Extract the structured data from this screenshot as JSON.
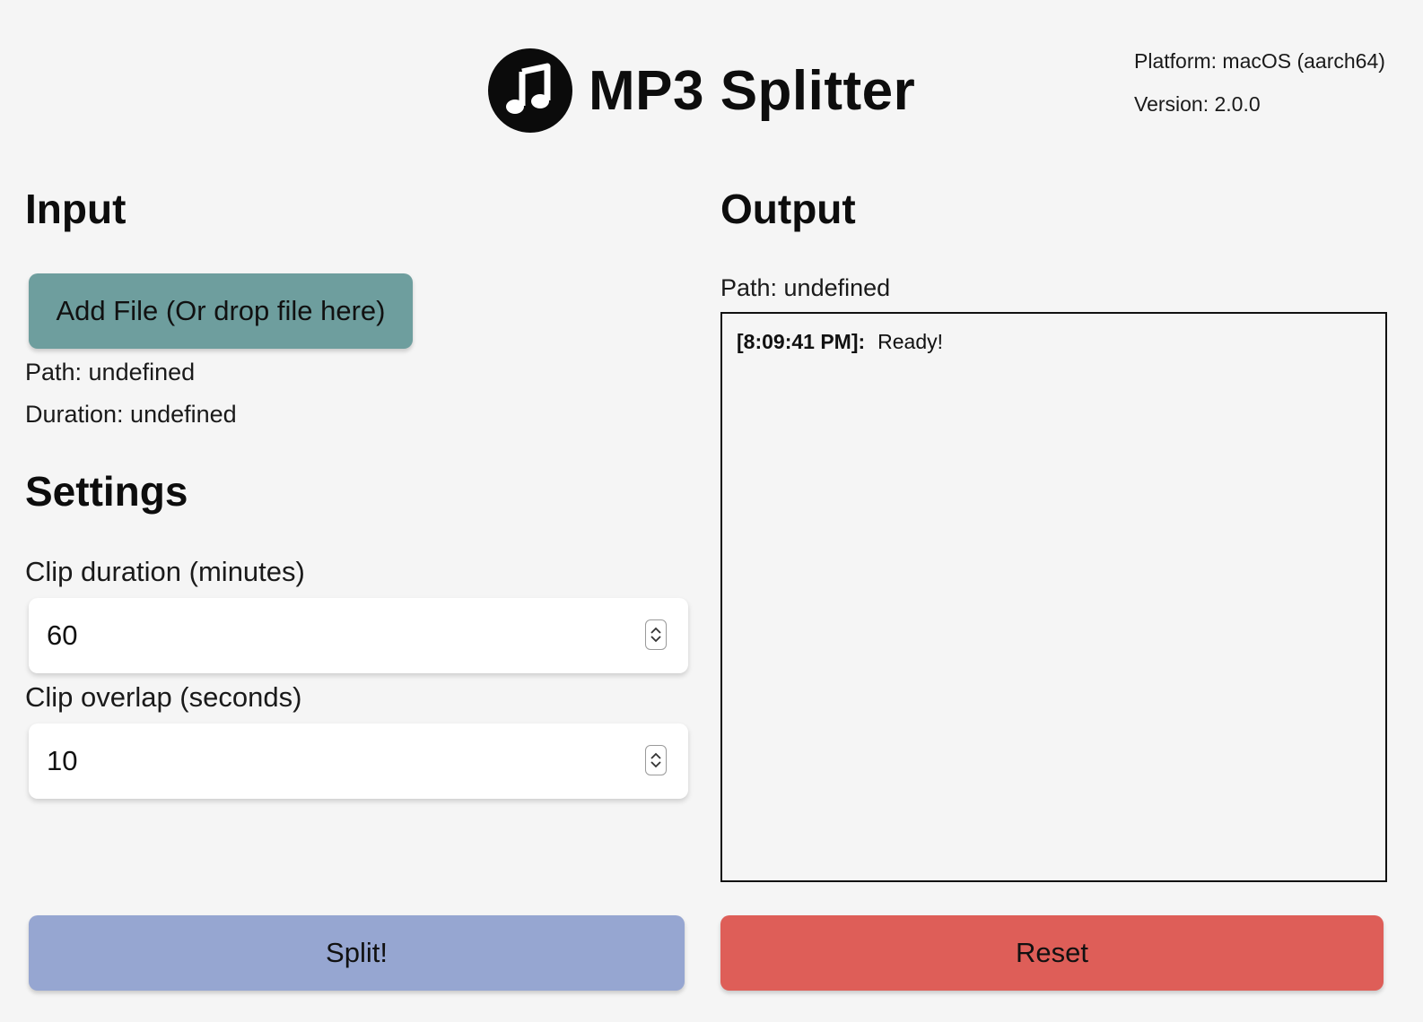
{
  "header": {
    "title": "MP3 Splitter",
    "logo_icon": "music-note-icon",
    "platform": "Platform: macOS (aarch64)",
    "version": "Version: 2.0.0"
  },
  "input": {
    "heading": "Input",
    "add_file_label": "Add File (Or drop file here)",
    "path": "Path: undefined",
    "duration": "Duration: undefined"
  },
  "settings": {
    "heading": "Settings",
    "clip_duration_label": "Clip duration (minutes)",
    "clip_duration_value": "60",
    "clip_overlap_label": "Clip overlap (seconds)",
    "clip_overlap_value": "10"
  },
  "output": {
    "heading": "Output",
    "path": "Path: undefined",
    "log": [
      {
        "time": "[8:09:41 PM]:",
        "message": "Ready!"
      }
    ]
  },
  "actions": {
    "split_label": "Split!",
    "reset_label": "Reset"
  },
  "colors": {
    "background": "#f5f5f5",
    "add_file_button": "#6e9e9e",
    "split_button": "#96a6d1",
    "reset_button": "#de5e58"
  }
}
